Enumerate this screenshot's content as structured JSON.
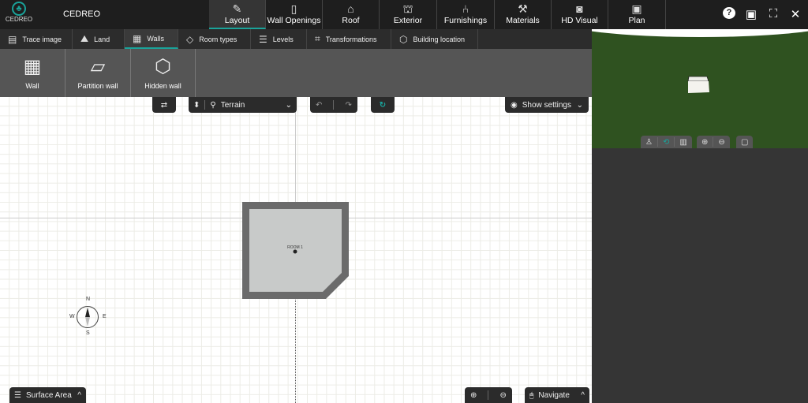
{
  "app": {
    "logo_text": "CEDREO",
    "brand": "CEDREO"
  },
  "main_tabs": [
    {
      "label": "Layout",
      "icon": "pencil-icon",
      "glyph": "✎",
      "active": true
    },
    {
      "label": "Wall Openings",
      "icon": "door-icon",
      "glyph": "▯"
    },
    {
      "label": "Roof",
      "icon": "roof-icon",
      "glyph": "⌂"
    },
    {
      "label": "Exterior",
      "icon": "exterior-icon",
      "glyph": "⛫"
    },
    {
      "label": "Furnishings",
      "icon": "armchair-icon",
      "glyph": "⑃"
    },
    {
      "label": "Materials",
      "icon": "paint-roller-icon",
      "glyph": "⚒"
    },
    {
      "label": "HD Visual",
      "icon": "camera-icon",
      "glyph": "◙"
    },
    {
      "label": "Plan",
      "icon": "plan-icon",
      "glyph": "▣"
    }
  ],
  "window_icons": {
    "help": "?",
    "save": "▣",
    "fullscreen": "⛶",
    "close": "✕"
  },
  "sub_tabs": [
    {
      "label": "Trace image",
      "glyph": "▤"
    },
    {
      "label": "Land",
      "glyph": "⛰"
    },
    {
      "label": "Walls",
      "glyph": "▦",
      "active": true
    },
    {
      "label": "Room types",
      "glyph": "◇"
    },
    {
      "label": "Levels",
      "glyph": "☰"
    },
    {
      "label": "Transformations",
      "glyph": "⌗"
    },
    {
      "label": "Building location",
      "glyph": "⬡"
    }
  ],
  "tools": [
    {
      "label": "Wall",
      "glyph": "▦"
    },
    {
      "label": "Partition wall",
      "glyph": "▱"
    },
    {
      "label": "Hidden wall",
      "glyph": "⬡"
    }
  ],
  "toolbar": {
    "swap": "⇄",
    "level_arrows": "⬍",
    "level_icon": "⚲",
    "level": "Terrain",
    "undo": "↶",
    "redo": "↷",
    "magnet": "↻",
    "show_settings": "Show settings",
    "eye": "◉",
    "chev": "⌄"
  },
  "room": {
    "name": "ROOM 1"
  },
  "compass": {
    "n": "N",
    "s": "S",
    "e": "E",
    "w": "W"
  },
  "bottom": {
    "surface_area": "Surface Area",
    "navigate": "Navigate",
    "zoom_in": "⊕",
    "zoom_out": "⊖",
    "mouse": "🖱",
    "list": "☰",
    "up": "^"
  },
  "view3d": {
    "person": "♙",
    "orbit": "⟲",
    "plan": "▥",
    "zoom_in": "⊕",
    "zoom_out": "⊖",
    "mouse": "▢"
  },
  "colors": {
    "accent": "#1aa39a",
    "grass": "#2f5220",
    "wall": "#6b6b6b",
    "floor": "#c8cac9"
  }
}
